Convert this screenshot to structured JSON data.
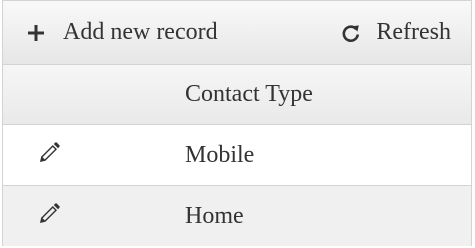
{
  "toolbar": {
    "add_label": "Add new record",
    "add_icon": "plus-icon",
    "refresh_label": "Refresh",
    "refresh_icon": "refresh-icon"
  },
  "grid": {
    "columns": [
      {
        "label": ""
      },
      {
        "label": "Contact Type"
      }
    ],
    "rows": [
      {
        "action_icon": "pencil-icon",
        "contact_type": "Mobile"
      },
      {
        "action_icon": "pencil-icon",
        "contact_type": "Home"
      }
    ]
  },
  "colors": {
    "text": "#333333",
    "border": "#d3d3d3",
    "alt_row": "#f0f0f0"
  }
}
